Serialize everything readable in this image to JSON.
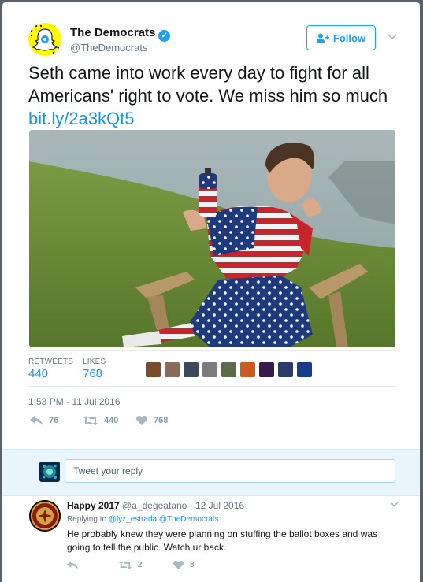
{
  "tweet": {
    "author_name": "The Democrats",
    "author_handle": "@TheDemocrats",
    "follow_label": "Follow",
    "text": "Seth came into work every day to fight for all Americans' right to vote. We miss him so much ",
    "link": "bit.ly/2a3kQt5",
    "photo_icon": "photo-man-in-flag-outfit",
    "stats": {
      "retweets_label": "RETWEETS",
      "retweets_value": "440",
      "likes_label": "LIKES",
      "likes_value": "768"
    },
    "timestamp": "1:53 PM - 11 Jul 2016",
    "actions": {
      "reply_count": "76",
      "retweet_count": "440",
      "like_count": "768"
    }
  },
  "composer": {
    "placeholder": "Tweet your reply"
  },
  "reply": {
    "name": "Happy 2017",
    "handle": "@a_degeatano",
    "date": "12 Jul 2016",
    "replying_prefix": "Replying to",
    "replying_mention_1": "@lyz_estrada",
    "replying_mention_2": "@TheDemocrats",
    "text": "He probably knew they were planning on stuffing the ballot boxes and was going to tell the public. Watch ur back.",
    "retweet_count": "2",
    "like_count": "8"
  },
  "colors": {
    "accent": "#1da1f2",
    "link": "#1b95e0",
    "muted": "#657786",
    "snapchat_yellow": "#fffc00"
  }
}
